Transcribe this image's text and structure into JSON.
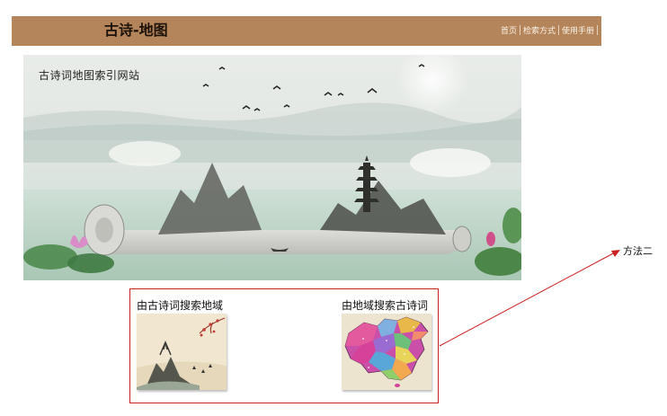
{
  "header": {
    "title": "古诗-地图",
    "nav": [
      {
        "label": "首页"
      },
      {
        "label": "检索方式"
      },
      {
        "label": "使用手册"
      }
    ]
  },
  "banner": {
    "caption": "古诗词地图索引网站"
  },
  "search_options": [
    {
      "label": "由古诗词搜索地域",
      "image": "ink-landscape-thumbnail"
    },
    {
      "label": "由地域搜索古诗词",
      "image": "china-map-thumbnail"
    }
  ],
  "annotation": {
    "label": "方法二",
    "color": "#cc1f1f"
  },
  "colors": {
    "header_bg": "#b4845a",
    "annotation_red": "#cc1f1f"
  }
}
